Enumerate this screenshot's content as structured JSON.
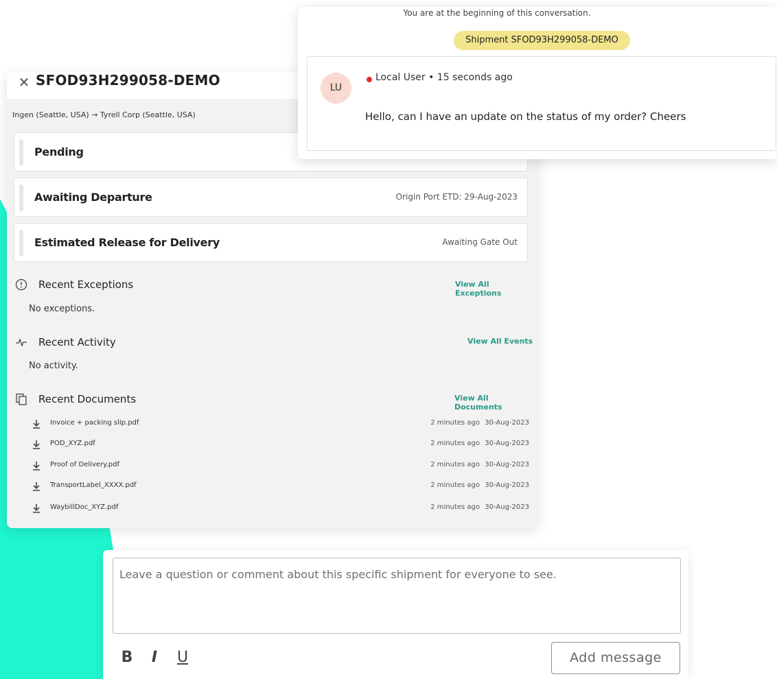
{
  "colors": {
    "accent_teal": "#1ff5cf",
    "link": "#2a9a8a",
    "shipment_tag": "#f3e58c",
    "avatar_bg": "#f9d9d0",
    "presence": "#e82a2a"
  },
  "shipment_panel": {
    "title": "SFOD93H299058-DEMO",
    "close_icon": "close-icon",
    "route": "Ingen (Seattle, USA) → Tyrell Corp (Seattle, USA)",
    "statuses": [
      {
        "label": "Pending",
        "detail": ""
      },
      {
        "label": "Awaiting Departure",
        "detail": "Origin Port ETD: 29-Aug-2023"
      },
      {
        "label": "Estimated Release for Delivery",
        "detail": "Awaiting Gate Out"
      }
    ],
    "exceptions": {
      "icon": "alert-circle-icon",
      "title": "Recent Exceptions",
      "link": "View All Exceptions",
      "empty": "No exceptions."
    },
    "activity": {
      "icon": "activity-icon",
      "title": "Recent Activity",
      "link": "View All Events",
      "empty": "No activity."
    },
    "documents": {
      "icon": "documents-icon",
      "title": "Recent Documents",
      "link": "View All Documents",
      "items": [
        {
          "name": "Invoice + packing slip.pdf",
          "ago": "2 minutes ago",
          "date": "30-Aug-2023"
        },
        {
          "name": "POD_XYZ.pdf",
          "ago": "2 minutes ago",
          "date": "30-Aug-2023"
        },
        {
          "name": "Proof of Delivery.pdf",
          "ago": "2 minutes ago",
          "date": "30-Aug-2023"
        },
        {
          "name": "TransportLabel_XXXX.pdf",
          "ago": "2 minutes ago",
          "date": "30-Aug-2023"
        },
        {
          "name": "WaybillDoc_XYZ.pdf",
          "ago": "2 minutes ago",
          "date": "30-Aug-2023"
        }
      ]
    }
  },
  "conversation": {
    "intro": "You are at the beginning of this conversation.",
    "shipment_tag": "Shipment SFOD93H299058-DEMO",
    "message": {
      "avatar_initials": "LU",
      "author_line": "Local User • 15 seconds ago",
      "text": "Hello, can I have an update on the status of my order? Cheers"
    }
  },
  "composer": {
    "placeholder": "Leave a question or comment about this specific shipment for everyone to see.",
    "value": "",
    "bold_label": "B",
    "italic_label": "I",
    "underline_label": "U",
    "submit_label": "Add message"
  }
}
